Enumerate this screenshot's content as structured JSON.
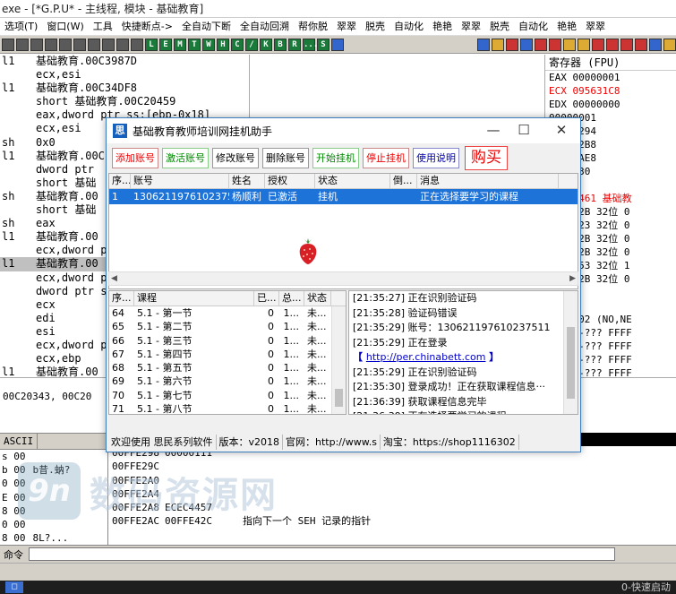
{
  "debugger": {
    "title": "exe - [*G.P.U* - 主线程, 模块 - 基础教育]",
    "menu": [
      "选项(T)",
      "窗口(W)",
      "工具",
      "快捷断点->",
      "全自动下断",
      "全自动回溯",
      "帮你脱",
      "翠翠",
      "脱壳",
      "自动化",
      "艳艳",
      "翠翠",
      "脱壳",
      "自动化",
      "艳艳",
      "翠翠"
    ],
    "toolbar_letters": [
      "L",
      "E",
      "M",
      "T",
      "W",
      "H",
      "C",
      "/",
      "K",
      "B",
      "R",
      "...",
      "S"
    ],
    "code_lines": [
      {
        "l": "l1",
        "r": "基础教育.00C3987D"
      },
      {
        "l": "",
        "r": "ecx,esi"
      },
      {
        "l": "l1",
        "r": "基础教育.00C34DF8"
      },
      {
        "l": "",
        "r": "short 基础教育.00C20459"
      },
      {
        "l": "",
        "r": "eax,dword ptr ss:[ebp-0x18]"
      },
      {
        "l": "",
        "r": "ecx,esi"
      },
      {
        "l": "sh",
        "r": "0x0"
      },
      {
        "l": "l1",
        "r": "基础教育.00C"
      },
      {
        "l": "",
        "r": "dword ptr"
      },
      {
        "l": "",
        "r": "short 基础"
      },
      {
        "l": "sh",
        "r": "基础教育.00"
      },
      {
        "l": "",
        "r": "short 基础"
      },
      {
        "l": "sh",
        "r": "eax"
      },
      {
        "l": "l1",
        "r": "基础教育.00"
      },
      {
        "l": "",
        "r": "ecx,dword p"
      },
      {
        "l": "l1",
        "r": "基础教育.00"
      },
      {
        "l": "",
        "r": "ecx,dword p"
      },
      {
        "l": "",
        "r": "dword ptr s"
      },
      {
        "l": "",
        "r": "ecx"
      },
      {
        "l": "",
        "r": "edi"
      },
      {
        "l": "",
        "r": "esi"
      },
      {
        "l": "",
        "r": "ecx,dword p"
      },
      {
        "l": "",
        "r": "ecx,ebp"
      },
      {
        "l": "l1",
        "r": "基础教育.00"
      }
    ],
    "registers": {
      "header": "寄存器 (FPU)",
      "lines": [
        {
          "t": "EAX 00000001",
          "red": false
        },
        {
          "t": "ECX 095631C8",
          "red": true
        },
        {
          "t": "EDX 00000000",
          "red": false
        },
        {
          "t": "    00000001",
          "red": false
        },
        {
          "t": "    00FFE294",
          "red": false
        },
        {
          "t": "    00FFE2B8",
          "red": false
        },
        {
          "t": "    00FFEAE8",
          "red": false
        },
        {
          "t": "    141FF30",
          "red": false
        },
        {
          "t": "",
          "red": false
        },
        {
          "t": "00C20461 基础教",
          "red": true
        },
        {
          "t": "ES 002B 32位 0",
          "red": false
        },
        {
          "t": "CS 0023 32位 0",
          "red": false
        },
        {
          "t": "SS 002B 32位 0",
          "red": false
        },
        {
          "t": "DS 002B 32位 0",
          "red": false
        },
        {
          "t": "FS 0053 32位 1",
          "red": false
        },
        {
          "t": "GS 002B 32位 0",
          "red": false
        },
        {
          "t": "",
          "red": false
        },
        {
          "t": "",
          "red": false
        },
        {
          "t": "0000202 (NO,NE",
          "red": false
        },
        {
          "t": "mpty -??? FFFF",
          "red": false
        },
        {
          "t": "mpty -??? FFFF",
          "red": false
        },
        {
          "t": "mpty -??? FFFF",
          "red": false
        },
        {
          "t": "mpty -??? FFFF",
          "red": false
        },
        {
          "t": "mpty 153.0000",
          "red": false
        },
        {
          "t": "mpty 255.0000",
          "red": false
        }
      ]
    },
    "info_line": "00C20343, 00C20",
    "dump_header": "ASCII",
    "dump_lines": [
      "s 00",
      "b 00",
      "0 00",
      "E 00",
      "8 00",
      "0 00",
      "8 00",
      "0 00"
    ],
    "dump_ascii": [
      "",
      "b昔.蚋?",
      "",
      "",
      "",
      "",
      "8L?...",
      "...被?"
    ],
    "stack_lines": [
      {
        "a": "00FFE294",
        "c": "ECEC4457",
        "sel": true
      },
      {
        "a": "00FFE298",
        "c": "00000111",
        "sel": false
      },
      {
        "a": "00FFE29C",
        "c": "",
        "sel": false
      },
      {
        "a": "00FFE2A0",
        "c": "",
        "sel": false
      },
      {
        "a": "00FFE2A4",
        "c": "",
        "sel": false
      },
      {
        "a": "00FFE2A8",
        "c": "ECEC4457",
        "sel": false
      },
      {
        "a": "00FFE2AC",
        "c": "00FFE42C",
        "sel": false
      },
      {
        "a": "",
        "c": "",
        "sel": false
      }
    ],
    "stack_comment": "指向下一个 SEH 记录的指针",
    "command_label": "命令",
    "taskbar_right": "0-快速启动"
  },
  "watermark": {
    "logo": "9n",
    "text": "数码资源网"
  },
  "dialog": {
    "title": "基础教育教师培训网挂机助手",
    "icon": "思",
    "buttons": [
      {
        "label": "添加账号",
        "style": "red"
      },
      {
        "label": "激活账号",
        "style": "grn"
      },
      {
        "label": "修改账号",
        "style": "blk"
      },
      {
        "label": "删除账号",
        "style": "blk"
      },
      {
        "label": "开始挂机",
        "style": "grn"
      },
      {
        "label": "停止挂机",
        "style": "red"
      },
      {
        "label": "使用说明",
        "style": "blu"
      },
      {
        "label": "购买",
        "style": "buy"
      }
    ],
    "account_table": {
      "headers": [
        "序...",
        "账号",
        "姓名",
        "授权",
        "状态",
        "倒...",
        "消息"
      ],
      "rows": [
        [
          "1",
          "130621197610237511",
          "杨顺利",
          "已激活",
          "挂机",
          "",
          "正在选择要学习的课程"
        ]
      ]
    },
    "course_table": {
      "headers": [
        "序...",
        "课程",
        "已...",
        "总...",
        "状态"
      ],
      "rows": [
        [
          "64",
          "5.1 - 第一节",
          "0",
          "1...",
          "未..."
        ],
        [
          "65",
          "5.1 - 第二节",
          "0",
          "1...",
          "未..."
        ],
        [
          "66",
          "5.1 - 第三节",
          "0",
          "1...",
          "未..."
        ],
        [
          "67",
          "5.1 - 第四节",
          "0",
          "1...",
          "未..."
        ],
        [
          "68",
          "5.1 - 第五节",
          "0",
          "1...",
          "未..."
        ],
        [
          "69",
          "5.1 - 第六节",
          "0",
          "1...",
          "未..."
        ],
        [
          "70",
          "5.1 - 第七节",
          "0",
          "1...",
          "未..."
        ],
        [
          "71",
          "5.1 - 第八节",
          "0",
          "1...",
          "未..."
        ]
      ]
    },
    "log_lines": [
      {
        "t": "[21:35:27] 正在识别验证码"
      },
      {
        "t": "[21:35:28] 验证码错误"
      },
      {
        "t": "[21:35:29] 账号：130621197610237511"
      },
      {
        "t": "[21:35:29] 正在登录"
      },
      {
        "t": "",
        "link": "http://per.chinabett.com"
      },
      {
        "t": "[21:35:29] 正在识别验证码"
      },
      {
        "t": "[21:35:30] 登录成功！正在获取课程信息···"
      },
      {
        "t": "[21:36:39] 获取课程信息完毕"
      },
      {
        "t": "[21:36:39] 正在选择要学习的课程"
      }
    ],
    "status": [
      "欢迎使用 思民系列软件",
      "版本：v2018",
      "官网：http://www.s",
      "淘宝：https://shop1116302"
    ]
  }
}
